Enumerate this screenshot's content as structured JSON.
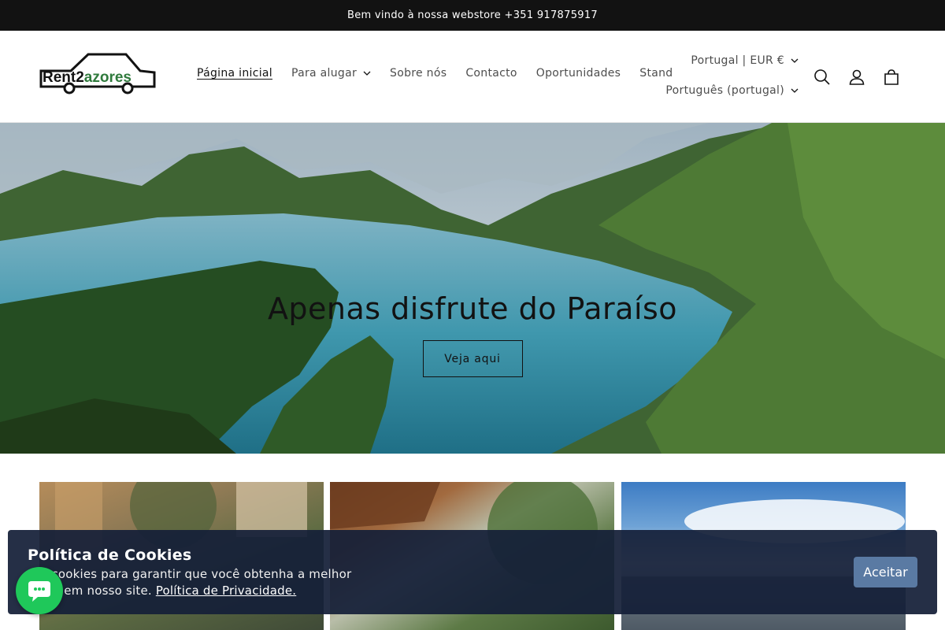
{
  "announcement": {
    "text": "Bem vindo à nossa webstore +351 917875917"
  },
  "header": {
    "logo_text": {
      "prefix": "Rent2",
      "suffix": "azores"
    },
    "nav": [
      {
        "label": "Página inicial",
        "active": true,
        "dropdown": false
      },
      {
        "label": "Para alugar",
        "active": false,
        "dropdown": true
      },
      {
        "label": "Sobre nós",
        "active": false,
        "dropdown": false
      },
      {
        "label": "Contacto",
        "active": false,
        "dropdown": false
      },
      {
        "label": "Oportunidades",
        "active": false,
        "dropdown": false
      },
      {
        "label": "Stand",
        "active": false,
        "dropdown": false
      }
    ],
    "country_selector": "Portugal | EUR €",
    "language_selector": "Português (portugal)",
    "icons": [
      "search-icon",
      "account-icon",
      "cart-icon"
    ]
  },
  "hero": {
    "title": "Apenas disfrute do Paraíso",
    "button_label": "Veja aqui"
  },
  "cookie_banner": {
    "title": "Política de Cookies",
    "text": "...sos cookies para garantir que você obtenha a melhor ...ência em nosso site.",
    "text_line1": "sos cookies para garantir que você obtenha a melhor",
    "text_line2": "ência em nosso site.",
    "link_label": "Política de Privacidade.",
    "accept_label": "Aceitar"
  },
  "colors": {
    "announcement_bg": "#121212",
    "cookie_bg": "#141f38",
    "accept_button": "#5a7aa3",
    "chat_button": "#1fc85a"
  }
}
